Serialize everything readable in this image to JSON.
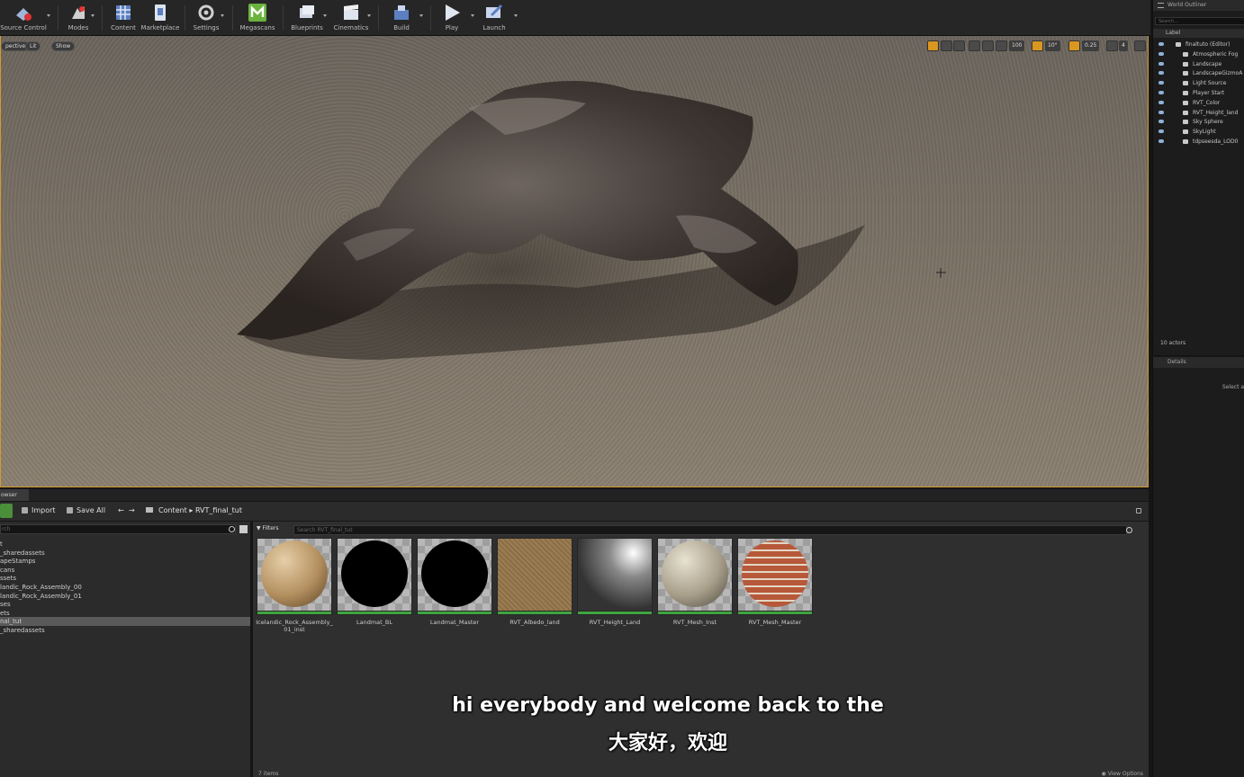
{
  "toolbar": {
    "items": [
      {
        "label": "Source Control",
        "icon": "source-control-icon"
      },
      {
        "label": "Modes",
        "icon": "modes-icon"
      },
      {
        "label": "Content",
        "icon": "content-icon"
      },
      {
        "label": "Marketplace",
        "icon": "marketplace-icon"
      },
      {
        "label": "Settings",
        "icon": "settings-icon"
      },
      {
        "label": "Megascans",
        "icon": "megascans-icon"
      },
      {
        "label": "Blueprints",
        "icon": "blueprints-icon"
      },
      {
        "label": "Cinematics",
        "icon": "cinematics-icon"
      },
      {
        "label": "Build",
        "icon": "build-icon"
      },
      {
        "label": "Play",
        "icon": "play-icon"
      },
      {
        "label": "Launch",
        "icon": "launch-icon"
      }
    ]
  },
  "viewport": {
    "perspective_label": "pective",
    "lit_label": "Lit",
    "show_label": "Show",
    "grid_value": "100",
    "rotation_value": "10°",
    "scale_value": "0.25",
    "camera_speed": "4"
  },
  "outliner": {
    "tab": "World Outliner",
    "search_placeholder": "Search...",
    "header": "Label",
    "items": [
      "finaltuto (Editor)",
      "Atmospheric Fog",
      "Landscape",
      "LandscapeGizmoA",
      "Light Source",
      "Player Start",
      "RVT_Color",
      "RVT_Height_land",
      "Sky Sphere",
      "SkyLight",
      "tdpseesda_LOD0"
    ],
    "actor_count": "10 actors"
  },
  "details": {
    "tab": "Details",
    "hint": "Select a"
  },
  "content_browser": {
    "tab": "owser",
    "import_label": "Import",
    "save_all_label": "Save All",
    "breadcrumb": [
      "Content",
      "RVT_final_tut"
    ],
    "folder_search_placeholder": "rch",
    "folders": [
      "t",
      "_sharedassets",
      "apeStamps",
      "cans",
      "ssets",
      "landic_Rock_Assembly_00",
      "landic_Rock_Assembly_01",
      "ses",
      "ets",
      "nal_tut",
      "_sharedassets"
    ],
    "selected_folder_index": 9,
    "filters_label": "Filters",
    "asset_search_placeholder": "Search RVT_final_tut",
    "assets": [
      {
        "name": "Icelandic_Rock_Assembly_01_inst",
        "display_line1": "Icelandic_Rock_Assembly_",
        "display_line2": "01_inst",
        "thumb": "sand-sphere"
      },
      {
        "name": "Landmat_BL",
        "display_line1": "Landmat_BL",
        "display_line2": "",
        "thumb": "black-sphere"
      },
      {
        "name": "Landmat_Master",
        "display_line1": "Landmat_Master",
        "display_line2": "",
        "thumb": "black-sphere"
      },
      {
        "name": "RVT_Albedo_land",
        "display_line1": "RVT_Albedo_land",
        "display_line2": "",
        "thumb": "albedo-texture"
      },
      {
        "name": "RVT_Height_Land",
        "display_line1": "RVT_Height_Land",
        "display_line2": "",
        "thumb": "height-texture"
      },
      {
        "name": "RVT_Mesh_Inst",
        "display_line1": "RVT_Mesh_Inst",
        "display_line2": "",
        "thumb": "rock-sphere"
      },
      {
        "name": "RVT_Mesh_Master",
        "display_line1": "RVT_Mesh_Master",
        "display_line2": "",
        "thumb": "brick-sphere"
      }
    ],
    "item_count": "7 items",
    "view_options": "View Options"
  },
  "subtitles": {
    "english": "hi everybody and welcome back to the",
    "chinese": "大家好，欢迎"
  },
  "colors": {
    "viewport_border": "#d39a2d",
    "megascans_green": "#6ab33e",
    "add_button_green": "#4a8f3a",
    "asset_bar_green": "#3fa43f"
  }
}
